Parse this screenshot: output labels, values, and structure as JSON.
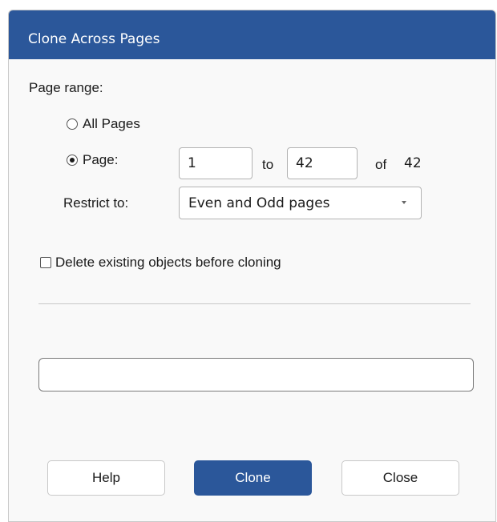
{
  "window": {
    "title": "Clone Across Pages"
  },
  "page_range": {
    "label": "Page range:",
    "all_pages_label": "All Pages",
    "page_label": "Page:",
    "selected_option": "page",
    "from_value": "1",
    "to_label": "to",
    "to_value": "42",
    "of_label": "of",
    "total_pages": "42"
  },
  "restrict": {
    "label": "Restrict to:",
    "selected": "Even and Odd pages"
  },
  "delete_existing": {
    "label": "Delete existing objects before cloning",
    "checked": false
  },
  "progress": {
    "value": 0
  },
  "buttons": {
    "help": "Help",
    "clone": "Clone",
    "close": "Close"
  },
  "colors": {
    "accent": "#2b579a"
  }
}
